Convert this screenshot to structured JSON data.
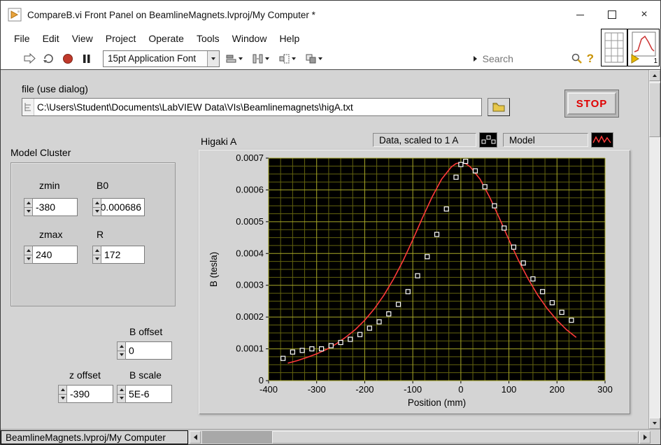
{
  "window": {
    "title": "CompareB.vi Front Panel on BeamlineMagnets.lvproj/My Computer *",
    "vi_icon_badge": "1"
  },
  "icons": {
    "close_glyph": "×",
    "help_glyph": "?"
  },
  "menu": {
    "items": [
      "File",
      "Edit",
      "View",
      "Project",
      "Operate",
      "Tools",
      "Window",
      "Help"
    ]
  },
  "toolbar": {
    "font_selector": "15pt Application Font",
    "search_placeholder": "Search"
  },
  "panel": {
    "file_control": {
      "label": "file (use dialog)",
      "path": "C:\\Users\\Student\\Documents\\LabVIEW Data\\VIs\\Beamlinemagnets\\higA.txt"
    },
    "stop_button": "STOP",
    "model_cluster": {
      "label": "Model Cluster",
      "controls": [
        {
          "label": "zmin",
          "value": "-380"
        },
        {
          "label": "B0",
          "value": "0.000686"
        },
        {
          "label": "zmax",
          "value": "240"
        },
        {
          "label": "R",
          "value": "172"
        }
      ]
    },
    "controls": [
      {
        "label": "B offset",
        "value": "0"
      },
      {
        "label": "z offset",
        "value": "-390"
      },
      {
        "label": "B scale",
        "value": "5E-6"
      }
    ]
  },
  "graph": {
    "title": "Higaki A"
  },
  "chart_data": {
    "type": "scatter",
    "title": "Higaki A",
    "xlabel": "Position (mm)",
    "ylabel": "B (tesla)",
    "xlim": [
      -400,
      300
    ],
    "ylim": [
      0,
      0.0007
    ],
    "x_ticks": [
      -400,
      -300,
      -200,
      -100,
      0,
      100,
      200,
      300
    ],
    "y_ticks": [
      0,
      0.0001,
      0.0002,
      0.0003,
      0.0004,
      0.0005,
      0.0006,
      0.0007
    ],
    "y_tick_labels": [
      "0",
      "0.0001",
      "0.0002",
      "0.0003",
      "0.0004",
      "0.0005",
      "0.0006",
      "0.0007"
    ],
    "grid": {
      "x_minor": 25,
      "y_minor": 2.5e-05,
      "major_color": "#a8a828",
      "minor_color": "#63630f",
      "bg": "#000000"
    },
    "legend_position": "top-right",
    "series": [
      {
        "name": "Data, scaled to 1 A",
        "type": "scatter",
        "marker": "open-square",
        "color": "#ffffff",
        "points": [
          [
            -370,
            7e-05
          ],
          [
            -350,
            9e-05
          ],
          [
            -330,
            9.5e-05
          ],
          [
            -310,
            0.0001
          ],
          [
            -290,
            0.0001
          ],
          [
            -270,
            0.00011
          ],
          [
            -250,
            0.00012
          ],
          [
            -230,
            0.00013
          ],
          [
            -210,
            0.000145
          ],
          [
            -190,
            0.000165
          ],
          [
            -170,
            0.000185
          ],
          [
            -150,
            0.00021
          ],
          [
            -130,
            0.00024
          ],
          [
            -110,
            0.00028
          ],
          [
            -90,
            0.00033
          ],
          [
            -70,
            0.00039
          ],
          [
            -50,
            0.00046
          ],
          [
            -30,
            0.00054
          ],
          [
            -10,
            0.00064
          ],
          [
            0,
            0.00068
          ],
          [
            10,
            0.00069
          ],
          [
            30,
            0.00066
          ],
          [
            50,
            0.00061
          ],
          [
            70,
            0.00055
          ],
          [
            90,
            0.00048
          ],
          [
            110,
            0.00042
          ],
          [
            130,
            0.00037
          ],
          [
            150,
            0.00032
          ],
          [
            170,
            0.00028
          ],
          [
            190,
            0.000245
          ],
          [
            210,
            0.000215
          ],
          [
            230,
            0.00019
          ]
        ]
      },
      {
        "name": "Model",
        "type": "line",
        "color": "#ff3a3a",
        "points": [
          [
            -360,
            5.5e-05
          ],
          [
            -340,
            6.3e-05
          ],
          [
            -320,
            7.3e-05
          ],
          [
            -300,
            8.4e-05
          ],
          [
            -280,
            9.8e-05
          ],
          [
            -260,
            0.000115
          ],
          [
            -240,
            0.000136
          ],
          [
            -220,
            0.00016
          ],
          [
            -200,
            0.00019
          ],
          [
            -180,
            0.000226
          ],
          [
            -160,
            0.000269
          ],
          [
            -140,
            0.00032
          ],
          [
            -120,
            0.000378
          ],
          [
            -100,
            0.000443
          ],
          [
            -80,
            0.000512
          ],
          [
            -60,
            0.000577
          ],
          [
            -40,
            0.000634
          ],
          [
            -20,
            0.000672
          ],
          [
            -10,
            0.000683
          ],
          [
            0,
            0.000686
          ],
          [
            10,
            0.000683
          ],
          [
            20,
            0.000672
          ],
          [
            40,
            0.000634
          ],
          [
            60,
            0.000577
          ],
          [
            80,
            0.000512
          ],
          [
            100,
            0.000443
          ],
          [
            120,
            0.000378
          ],
          [
            140,
            0.00032
          ],
          [
            160,
            0.000269
          ],
          [
            180,
            0.000226
          ],
          [
            200,
            0.00019
          ],
          [
            220,
            0.00016
          ],
          [
            240,
            0.000136
          ]
        ]
      }
    ]
  },
  "statusbar": {
    "context": "BeamlineMagnets.lvproj/My Computer"
  }
}
